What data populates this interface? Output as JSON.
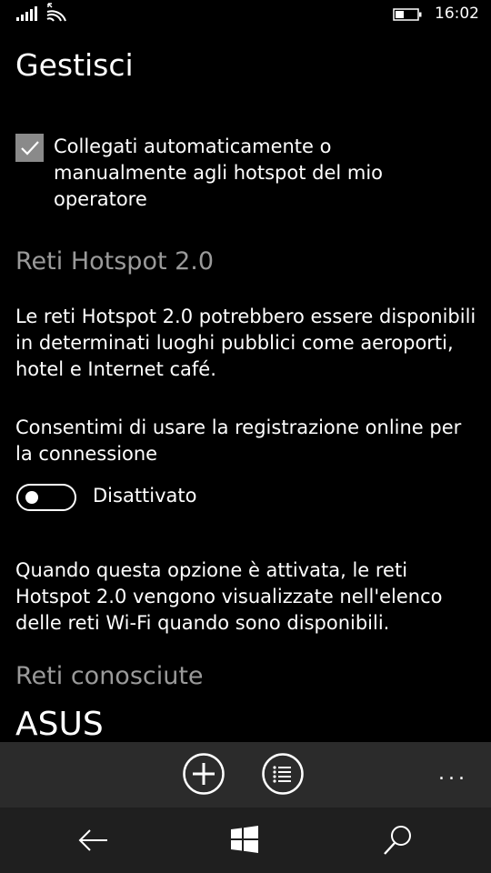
{
  "status_bar": {
    "time": "16:02",
    "icons": [
      "signal-icon",
      "wifi-icon",
      "battery-icon"
    ]
  },
  "page": {
    "title": "Gestisci"
  },
  "auto_connect": {
    "checked": true,
    "label": "Collegati automaticamente o manualmente agli hotspot del mio operatore"
  },
  "hotspot": {
    "section_title": "Reti Hotspot 2.0",
    "description": "Le reti Hotspot 2.0 potrebbero essere disponibili in determinati luoghi pubblici come aeroporti, hotel e Internet café.",
    "online_signup_label": "Consentimi di usare la registrazione online per la connessione",
    "toggle_state": "Disattivato",
    "toggle_on": false,
    "note": "Quando questa opzione è attivata, le reti Hotspot 2.0 vengono visualizzate nell'elenco delle reti Wi-Fi quando sono disponibili."
  },
  "known_networks": {
    "section_title": "Reti conosciute",
    "items": [
      "ASUS"
    ]
  },
  "app_bar": {
    "buttons": [
      "add-icon",
      "list-icon"
    ],
    "more_label": "..."
  },
  "nav_bar": {
    "buttons": [
      "back-icon",
      "windows-start-icon",
      "search-icon"
    ]
  },
  "colors": {
    "background": "#000000",
    "app_bar": "#2b2b2b",
    "nav_bar": "#1f1f1f",
    "section_title": "#9a9a9a",
    "checkbox": "#8a8a8a"
  }
}
